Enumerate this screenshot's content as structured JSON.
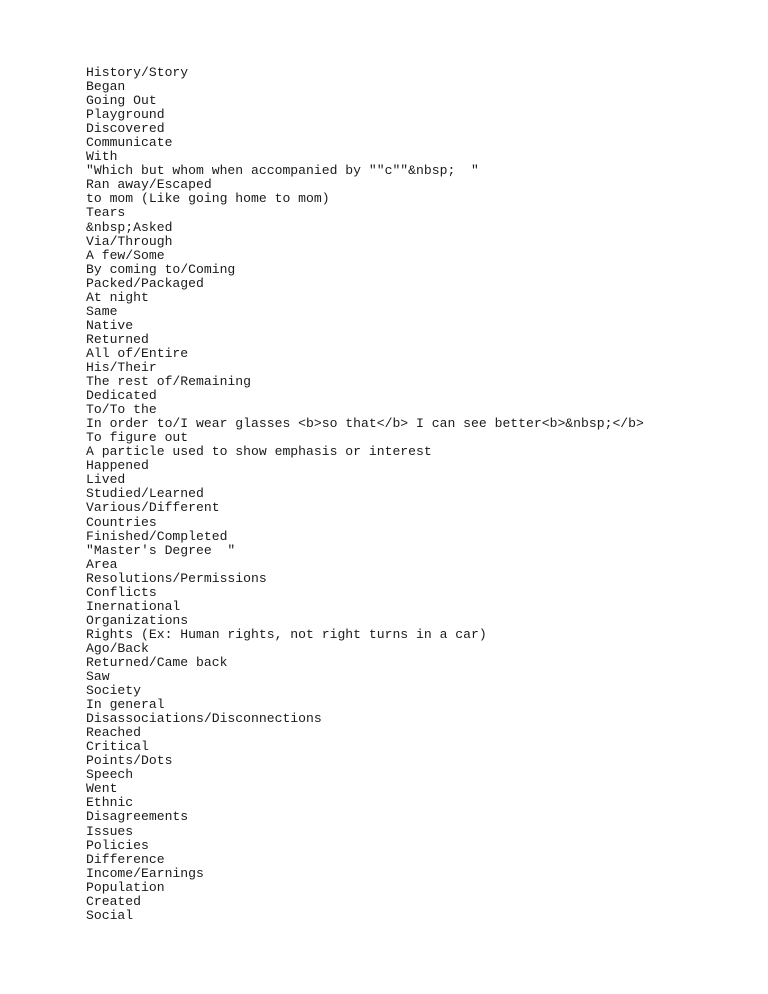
{
  "document": {
    "lines": [
      "History/Story",
      "Began",
      "Going Out",
      "Playground",
      "Discovered",
      "Communicate",
      "With",
      "\"Which but whom when accompanied by \"\"c\"\"&nbsp;  \"",
      "Ran away/Escaped",
      "to mom (Like going home to mom)",
      "Tears",
      "&nbsp;Asked",
      "Via/Through",
      "A few/Some",
      "By coming to/Coming",
      "Packed/Packaged",
      "At night",
      "Same",
      "Native",
      "Returned",
      "All of/Entire",
      "His/Their",
      "The rest of/Remaining",
      "Dedicated",
      "To/To the",
      "In order to/I wear glasses <b>so that</b> I can see better<b>&nbsp;</b>",
      "To figure out",
      "A particle used to show emphasis or interest",
      "Happened",
      "Lived",
      "Studied/Learned",
      "Various/Different",
      "Countries",
      "Finished/Completed",
      "\"Master's Degree  \"",
      "Area",
      "Resolutions/Permissions",
      "Conflicts",
      "Inernational",
      "Organizations",
      "Rights (Ex: Human rights, not right turns in a car)",
      "Ago/Back",
      "Returned/Came back",
      "Saw",
      "Society",
      "In general",
      "Disassociations/Disconnections",
      "Reached",
      "Critical",
      "Points/Dots",
      "Speech",
      "Went",
      "Ethnic",
      "Disagreements",
      "Issues",
      "Policies",
      "Difference",
      "Income/Earnings",
      "Population",
      "Created",
      "Social"
    ]
  }
}
